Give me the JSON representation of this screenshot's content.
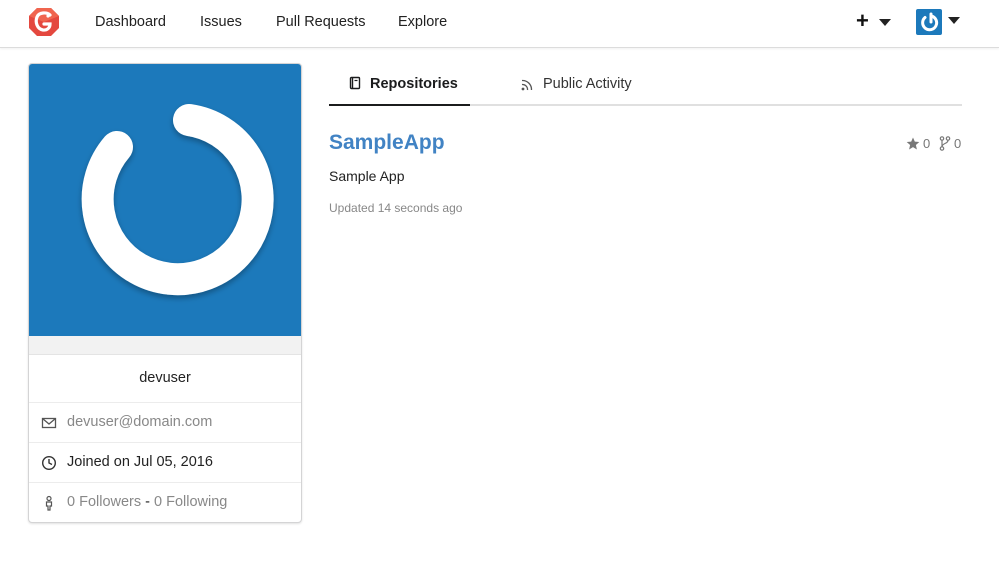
{
  "nav": {
    "links": [
      "Dashboard",
      "Issues",
      "Pull Requests",
      "Explore"
    ],
    "plus_label": "+",
    "accent": "#1c79bb",
    "logo_color": "#e4483f"
  },
  "profile": {
    "username": "devuser",
    "email": "devuser@domain.com",
    "joined": "Joined on Jul 05, 2016",
    "followers": "0 Followers",
    "separator": " - ",
    "following": "0 Following",
    "avatar_bg": "#1c79bb",
    "icons": {
      "email": "mail-icon",
      "joined": "clock-icon",
      "follow": "person-icon"
    }
  },
  "tabs": [
    {
      "label": "Repositories",
      "icon": "book-icon",
      "active": true
    },
    {
      "label": "Public Activity",
      "icon": "rss-icon",
      "active": false
    }
  ],
  "repos": [
    {
      "name": "SampleApp",
      "description": "Sample App",
      "updated": "Updated 14 seconds ago",
      "stars": "0",
      "forks": "0",
      "link_color": "#4183c4"
    }
  ]
}
